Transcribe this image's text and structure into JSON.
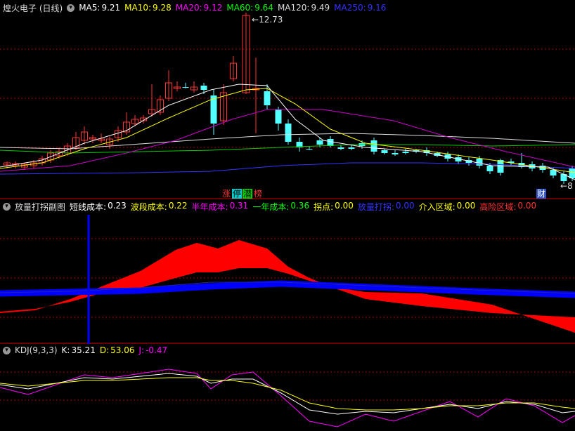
{
  "main_pane": {
    "title": "煌火电子 (日线)",
    "ma_items": [
      {
        "label": "MA5:",
        "value": "9.21",
        "color": "#ffffff"
      },
      {
        "label": "MA10:",
        "value": "9.28",
        "color": "#ffff00"
      },
      {
        "label": "MA20:",
        "value": "9.12",
        "color": "#ff00ff"
      },
      {
        "label": "MA60:",
        "value": "9.64",
        "color": "#00ff00"
      },
      {
        "label": "MA120:",
        "value": "9.49",
        "color": "#dddddd"
      },
      {
        "label": "MA250:",
        "value": "9.16",
        "color": "#3333ff"
      }
    ],
    "high_label": "12.73",
    "low_label": "8",
    "tags": [
      {
        "text": "涨",
        "color": "#ff3333"
      },
      {
        "text": "停",
        "color": "#00ffff"
      },
      {
        "text": "潜",
        "color": "#00ff00"
      },
      {
        "text": "榜",
        "color": "#ff3333"
      }
    ],
    "fin_tag": "财"
  },
  "indicator_pane": {
    "title": "放量打拐副图",
    "items": [
      {
        "label": "短线成本:",
        "value": "0.23",
        "color": "#ffffff"
      },
      {
        "label": "波段成本:",
        "value": "0.22",
        "color": "#ffff00"
      },
      {
        "label": "半年成本:",
        "value": "0.31",
        "color": "#ff00ff"
      },
      {
        "label": "一年成本:",
        "value": "0.36",
        "color": "#00ff00"
      },
      {
        "label": "拐点:",
        "value": "0.00",
        "color": "#ffff00"
      },
      {
        "label": "放量打拐:",
        "value": "0.00",
        "color": "#3333ff"
      },
      {
        "label": "介入区域:",
        "value": "0.00",
        "color": "#ffff00"
      },
      {
        "label": "高险区域:",
        "value": "0.00",
        "color": "#ff3333"
      }
    ]
  },
  "kdj_pane": {
    "title": "KDJ(9,3,3)",
    "items": [
      {
        "label": "K:",
        "value": "35.21",
        "color": "#ffffff"
      },
      {
        "label": "D:",
        "value": "53.06",
        "color": "#ffff00"
      },
      {
        "label": "J:",
        "value": "-0.47",
        "color": "#ff00ff"
      }
    ]
  },
  "colors": {
    "up": "#ff3333",
    "down": "#54ffff",
    "grid": "#ff0000"
  }
}
